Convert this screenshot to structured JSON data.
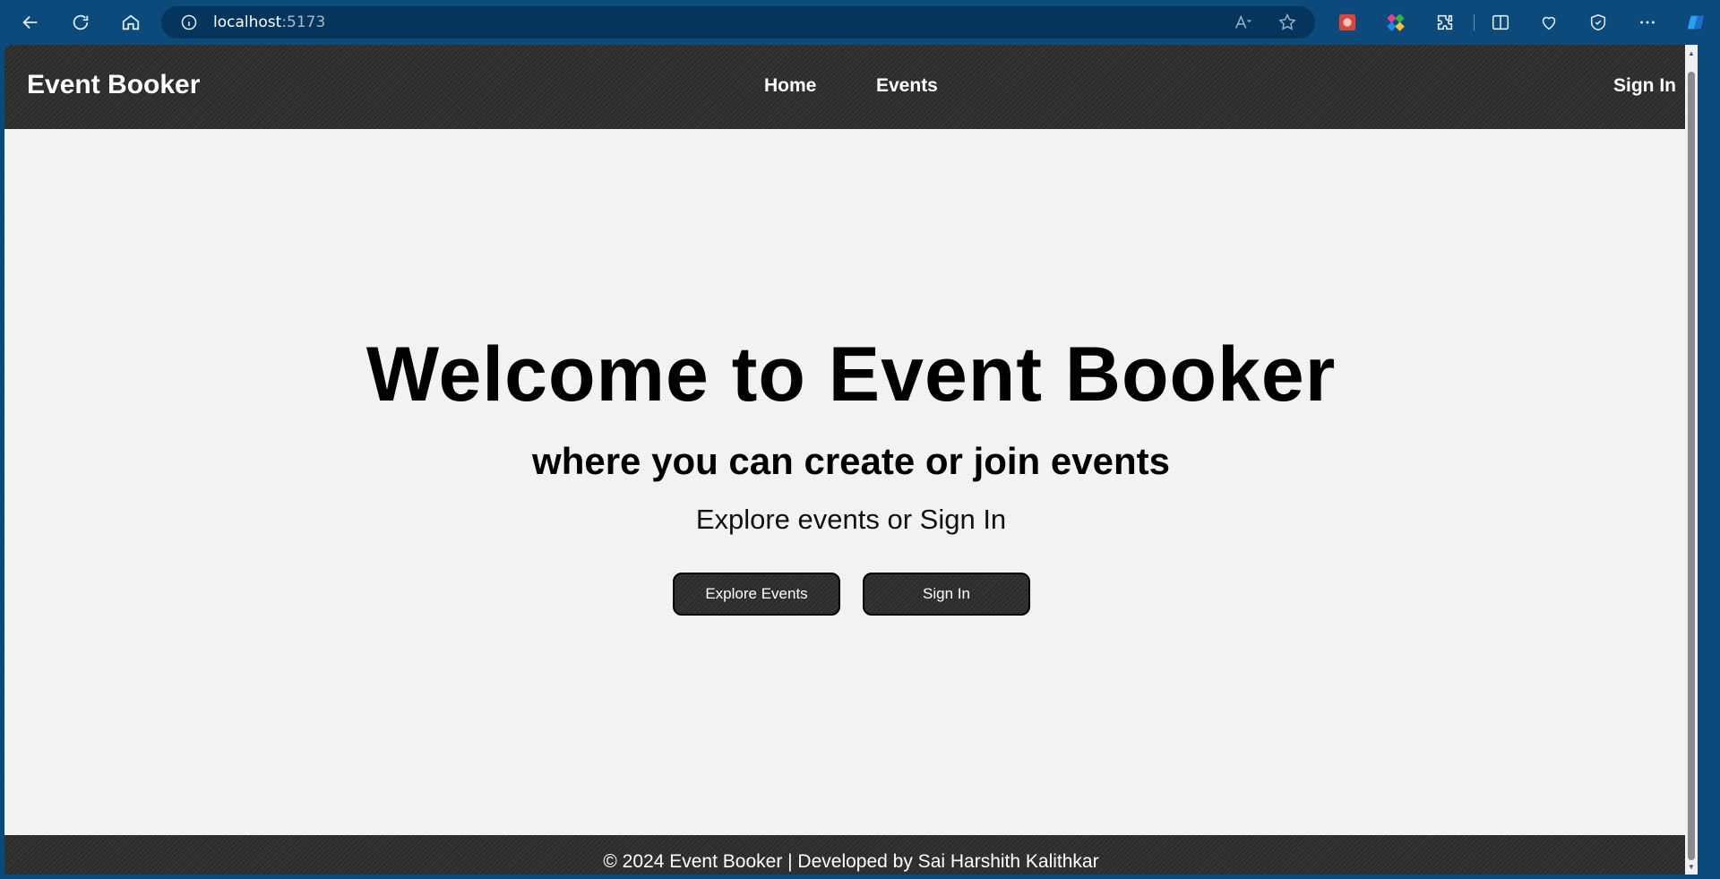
{
  "browser": {
    "url_host": "localhost",
    "url_port": ":5173",
    "icons": [
      "back-arrow-icon",
      "refresh-icon",
      "home-icon",
      "info-icon",
      "read-aloud-icon",
      "favorite-star-icon",
      "extension-red-icon",
      "extension-color-icon",
      "extensions-puzzle-icon",
      "split-screen-icon",
      "favorites-heart-icon",
      "browser-essentials-icon",
      "more-dots-icon",
      "copilot-icon"
    ]
  },
  "header": {
    "brand": "Event Booker",
    "nav": [
      "Home",
      "Events"
    ],
    "sign_in": "Sign In"
  },
  "hero": {
    "title": "Welcome to Event Booker",
    "subtitle": "where you can create or join events",
    "tagline": "Explore events or Sign In",
    "explore_button": "Explore Events",
    "signin_button": "Sign In"
  },
  "footer": {
    "text": "© 2024 Event Booker | Developed by Sai Harshith Kalithkar"
  },
  "colors": {
    "browser_chrome": "#0b4a7b",
    "address_bar": "#05355c",
    "header_bg": "#2f2f2f",
    "page_bg": "#f3f3f3",
    "button_bg": "#2f2f2f"
  }
}
